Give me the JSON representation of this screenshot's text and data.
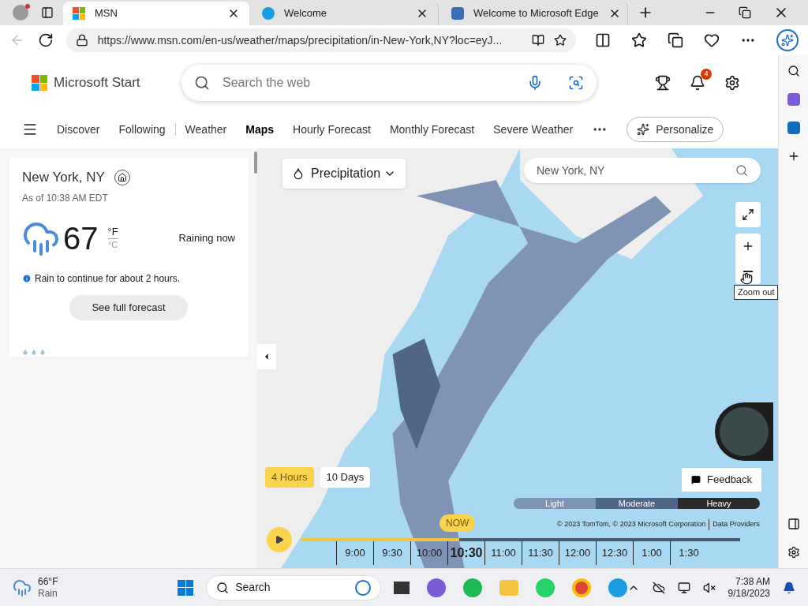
{
  "browser": {
    "tabs": [
      {
        "title": "MSN",
        "selected": true
      },
      {
        "title": "Welcome",
        "selected": false
      },
      {
        "title": "Welcome to Microsoft Edge",
        "selected": false
      }
    ],
    "back_disabled": true,
    "url": "https://www.msn.com/en-us/weather/maps/precipitation/in-New-York,NY?loc=eyJ..."
  },
  "header": {
    "logo": "Microsoft Start",
    "search_placeholder": "Search the web",
    "notifications": "4"
  },
  "nav": [
    {
      "label": "Discover",
      "selected": false
    },
    {
      "label": "Following",
      "selected": false
    },
    {
      "label": "Weather",
      "selected": false
    },
    {
      "label": "Maps",
      "selected": true
    },
    {
      "label": "Hourly Forecast",
      "selected": false
    },
    {
      "label": "Monthly Forecast",
      "selected": false
    },
    {
      "label": "Severe Weather",
      "selected": false
    }
  ],
  "personalize": "Personalize",
  "weather": {
    "location": "New York, NY",
    "as_of": "As of 10:38 AM EDT",
    "temp": "67",
    "unit_f": "°F",
    "unit_c": "°C",
    "condition": "Raining now",
    "alert": "Rain to continue for about 2 hours.",
    "button": "See full forecast"
  },
  "map": {
    "layer": "Precipitation",
    "search_value": "New York, NY",
    "tooltip": "Zoom out",
    "ranges": [
      {
        "label": "4 Hours",
        "selected": true
      },
      {
        "label": "10 Days",
        "selected": false
      }
    ],
    "feedback": "Feedback",
    "legend": [
      {
        "label": "Light",
        "color": "#7f93b5"
      },
      {
        "label": "Moderate",
        "color": "#4f6689"
      },
      {
        "label": "Heavy",
        "color": "#2b2b2b"
      }
    ],
    "copyright": "© 2023 TomTom, © 2023 Microsoft Corporation",
    "data_providers": "Data Providers",
    "now": "NOW",
    "progress": {
      "level": 0.36
    },
    "times": [
      {
        "label": "9:00",
        "selected": false
      },
      {
        "label": "9:30",
        "selected": false
      },
      {
        "label": "10:00",
        "selected": false
      },
      {
        "label": "10:30",
        "selected": true
      },
      {
        "label": "11:00",
        "selected": false
      },
      {
        "label": "11:30",
        "selected": false
      },
      {
        "label": "12:00",
        "selected": false
      },
      {
        "label": "12:30",
        "selected": false
      },
      {
        "label": "1:00",
        "selected": false
      },
      {
        "label": "1:30",
        "selected": false
      }
    ]
  },
  "taskbar": {
    "temp": "66°F",
    "condition": "Rain",
    "search": "Search",
    "time": "7:38 AM",
    "date": "9/18/2023"
  }
}
